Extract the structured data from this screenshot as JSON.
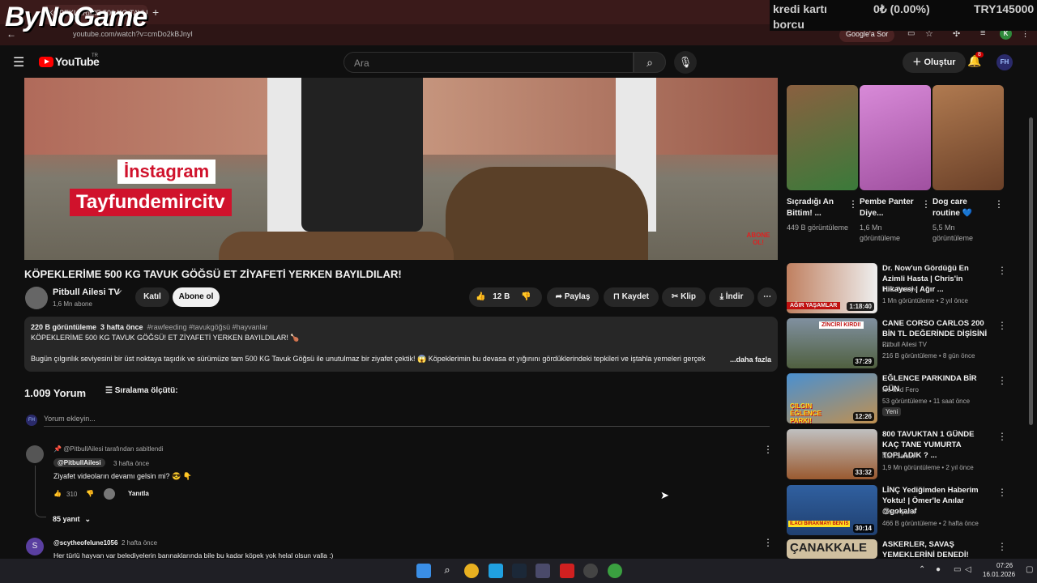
{
  "browser": {
    "tab_title": "KÖPEKLERİME 500 KG TAVU",
    "url": "youtube.com/watch?v=cmDo2kBJnyI",
    "google_btn": "Google'a Sor",
    "profile_letter": "K"
  },
  "overlay": {
    "logo": "ByNoGame",
    "stock_label_1": "kredi kartı",
    "stock_label_2": "borcu",
    "stock_change": "0₺ (0.00%)",
    "stock_symbol": "TRY145000"
  },
  "youtube": {
    "brand": "YouTube",
    "region": "TR",
    "search_placeholder": "Ara",
    "create_label": "Oluştur",
    "notif_count": "8",
    "user_initials": "FH"
  },
  "video": {
    "overlay_line1": "İnstagram",
    "overlay_line2": "Tayfundemircitv",
    "watermark": "ABONE OL!",
    "title": "KÖPEKLERİME 500 KG TAVUK GÖĞSÜ ET ZİYAFETİ YERKEN BAYILDILAR!",
    "channel": "Pitbull Ailesi TV",
    "subs": "1,6 Mn abone",
    "join": "Katıl",
    "subscribe": "Abone ol",
    "likes": "12 B",
    "share": "Paylaş",
    "save": "Kaydet",
    "clip": "Klip",
    "download": "İndir"
  },
  "description": {
    "views": "220 B görüntüleme",
    "age": "3 hafta önce",
    "tags": "#rawfeeding #tavukgöğsü #hayvanlar",
    "line1": "KÖPEKLERİME 500 KG TAVUK GÖĞSÜ! ET ZİYAFETİ YERKEN BAYILDILAR! 🍗",
    "line2": "Bugün çılgınlık seviyesini bir üst noktaya taşıdık ve sürümüze tam 500 KG Tavuk Göğsü ile unutulmaz bir ziyafet çektik! 😱 Köpeklerimin bu devasa et yığınını gördüklerindeki tepkileri ve iştahla yemeleri gerçek",
    "more": "...daha fazla"
  },
  "comments": {
    "count": "1.009 Yorum",
    "sort": "Sıralama ölçütü:",
    "add_placeholder": "Yorum ekleyin...",
    "pinned_by": "@PitbullAilesi tarafından sabitlendi",
    "c1_author": "@PitbullAilesi",
    "c1_age": "3 hafta önce",
    "c1_text": "Ziyafet videoların devamı gelsin mi? 😎 👇",
    "c1_likes": "310",
    "reply": "Yanıtla",
    "replies": "85 yanıt",
    "c2_author": "@scytheofelune1056",
    "c2_age": "2 hafta önce",
    "c2_text": "Her türlü hayvan var belediyelerin barınaklarında bile bu kadar köpek yok helal olsun valla :)",
    "c2_avatar": "S"
  },
  "shorts": [
    {
      "title": "Sıçradığı An Bittim! ...",
      "views": "449 B görüntüleme",
      "color": "#3a7a3a"
    },
    {
      "title": "Pembe Panter Diye...",
      "views": "1,6 Mn görüntüleme",
      "color": "#c070c0"
    },
    {
      "title": "Dog care routine 💙",
      "views": "5,5 Mn görüntüleme",
      "color": "#8a5a3a"
    }
  ],
  "related": [
    {
      "title": "Dr. Now'un Gördüğü En Azimli Hasta | Chris'in Hikayesi | Ağır ...",
      "channel": "TLC Türkiye",
      "meta": "1 Mn görüntüleme • 2 yıl önce",
      "duration": "1:18:40",
      "badge": "AĞIR YAŞAMLAR",
      "color": "#b07060"
    },
    {
      "title": "CANE CORSO CARLOS 200 BİN TL DEĞERİNDE DİŞİSİNİ ...",
      "channel": "Pitbull Ailesi TV",
      "meta": "216 B görüntüleme • 8 gün önce",
      "duration": "37:29",
      "badge": "ZİNCİRİ KIRDI!",
      "color": "#506040"
    },
    {
      "title": "EĞLENCE PARKINDA BİR GÜN",
      "channel": "Iso and Fero",
      "meta": "53 görüntüleme • 11 saat önce",
      "duration": "12:26",
      "badge": "ÇILGIN EĞLENCE PARKI!",
      "color": "#3070b0",
      "new": "Yeni"
    },
    {
      "title": "800 TAVUKTAN 1 GÜNDE KAÇ TANE YUMURTA TOPLADIK ? ...",
      "channel": "Nuri Saltan",
      "meta": "1,9 Mn görüntüleme • 2 yıl önce",
      "duration": "33:32",
      "color": "#9a5a30"
    },
    {
      "title": "LİNÇ Yediğimden Haberim Yoktu! | Ömer'le Anılar @gokalaf",
      "channel": "Ömer Şanlı",
      "meta": "466 B görüntüleme • 2 hafta önce",
      "duration": "30:14",
      "badge": "İLACI BIRAKMAYI BEN İS",
      "color": "#204070"
    },
    {
      "title": "ASKERLER, SAVAŞ YEMEKLERİNİ DENEDİ!",
      "badge": "ÇANAKKALE",
      "color": "#d0c0a0"
    }
  ],
  "system": {
    "time": "07:26",
    "date": "16.01.2026"
  }
}
